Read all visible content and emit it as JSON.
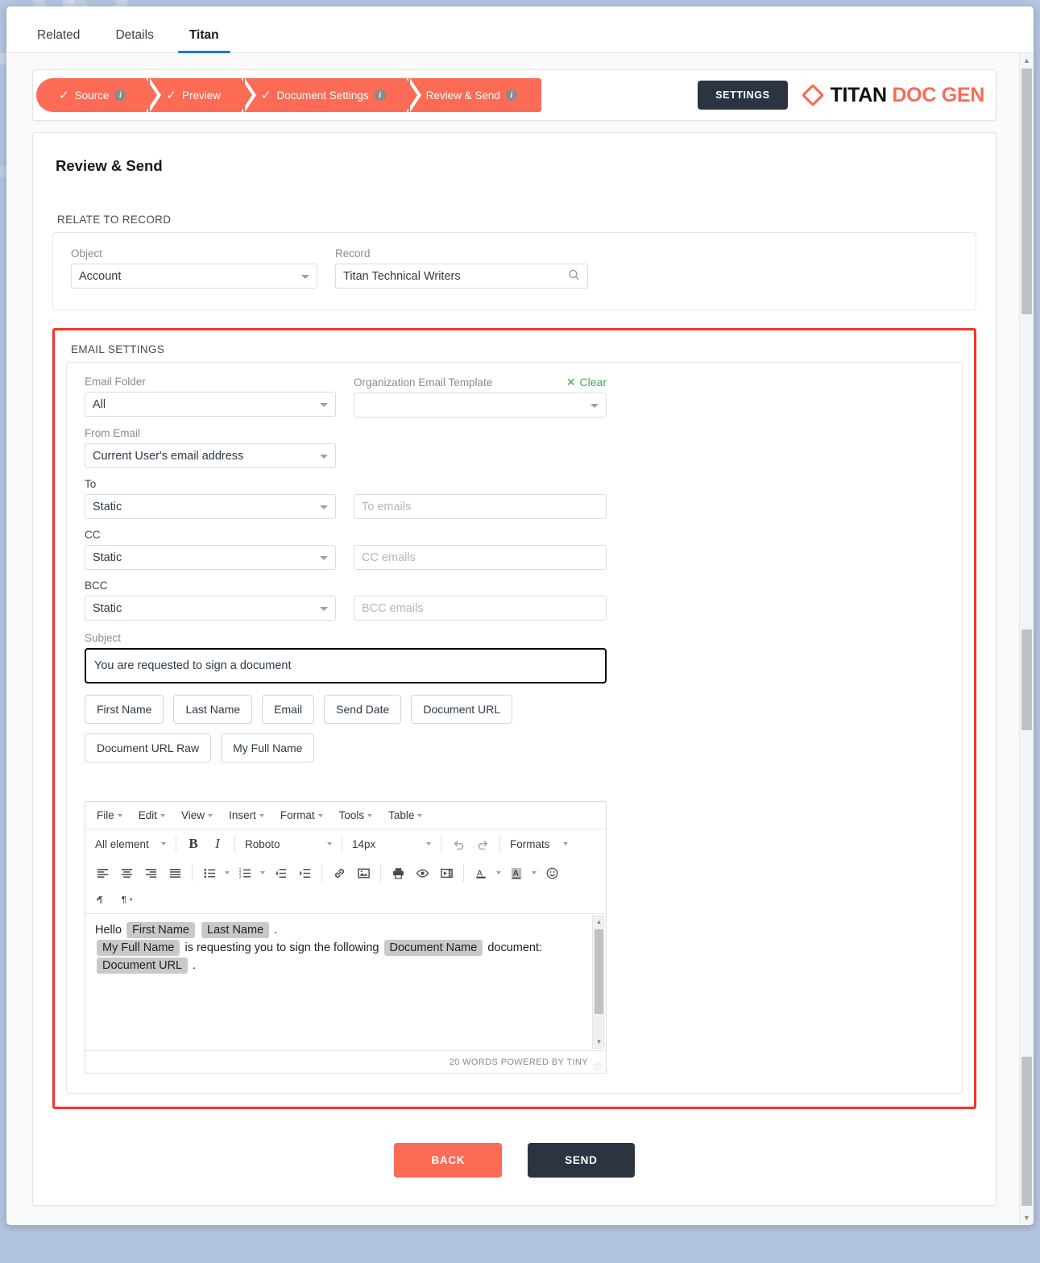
{
  "tabs": [
    {
      "label": "Related",
      "active": false
    },
    {
      "label": "Details",
      "active": false
    },
    {
      "label": "Titan",
      "active": true
    }
  ],
  "wizard": {
    "steps": [
      {
        "label": "Source",
        "done": true,
        "info": true
      },
      {
        "label": "Preview",
        "done": true,
        "info": false
      },
      {
        "label": "Document Settings",
        "done": true,
        "info": true
      },
      {
        "label": "Review & Send",
        "done": false,
        "info": true
      }
    ],
    "settings_button": "SETTINGS",
    "logo_primary": "TITAN",
    "logo_secondary": "DOC GEN",
    "accent_color": "#fb6b55",
    "dark_color": "#2b3440"
  },
  "page": {
    "title": "Review & Send",
    "relate_section_label": "RELATE TO RECORD",
    "email_section_label": "EMAIL SETTINGS",
    "highlight_color": "#f5342c"
  },
  "relate_to_record": {
    "object": {
      "label": "Object",
      "value": "Account"
    },
    "record": {
      "label": "Record",
      "value": "Titan Technical Writers",
      "icon": "search-icon"
    }
  },
  "email_settings": {
    "email_folder": {
      "label": "Email Folder",
      "value": "All"
    },
    "org_template": {
      "label": "Organization Email Template",
      "value": "",
      "clear_label": "Clear"
    },
    "from_email": {
      "label": "From Email",
      "value": "Current User's email address"
    },
    "to": {
      "label": "To",
      "mode": "Static",
      "placeholder": "To emails",
      "value": ""
    },
    "cc": {
      "label": "CC",
      "mode": "Static",
      "placeholder": "CC emails",
      "value": ""
    },
    "bcc": {
      "label": "BCC",
      "mode": "Static",
      "placeholder": "BCC emails",
      "value": ""
    },
    "subject": {
      "label": "Subject",
      "value": "You are requested to sign a document"
    },
    "merge_chips": [
      "First Name",
      "Last Name",
      "Email",
      "Send Date",
      "Document URL",
      "Document URL Raw",
      "My Full Name"
    ]
  },
  "editor": {
    "menus": [
      "File",
      "Edit",
      "View",
      "Insert",
      "Format",
      "Tools",
      "Table"
    ],
    "element_select": "All element",
    "font_family": "Roboto",
    "font_size": "14px",
    "formats_label": "Formats",
    "bold_label": "B",
    "italic_label": "I",
    "toolbar_icons": [
      "align-left-icon",
      "align-center-icon",
      "align-right-icon",
      "align-justify-icon",
      "bullet-list-icon",
      "numbered-list-icon",
      "outdent-icon",
      "indent-icon",
      "link-icon",
      "image-icon",
      "print-icon",
      "preview-icon",
      "media-icon",
      "text-color-icon",
      "background-color-icon",
      "emoji-icon",
      "ltr-icon",
      "rtl-icon"
    ],
    "body": {
      "line1_prefix": "Hello",
      "line1_fields": [
        "First Name",
        "Last Name"
      ],
      "line1_suffix": ".",
      "line2_field1": "My Full Name",
      "line2_mid": "is requesting you to sign the following",
      "line2_field2": "Document Name",
      "line2_suffix": "document:",
      "line3_field": "Document URL",
      "line3_suffix": "."
    },
    "status": "20 WORDS POWERED BY TINY"
  },
  "actions": {
    "back_label": "BACK",
    "send_label": "SEND"
  }
}
